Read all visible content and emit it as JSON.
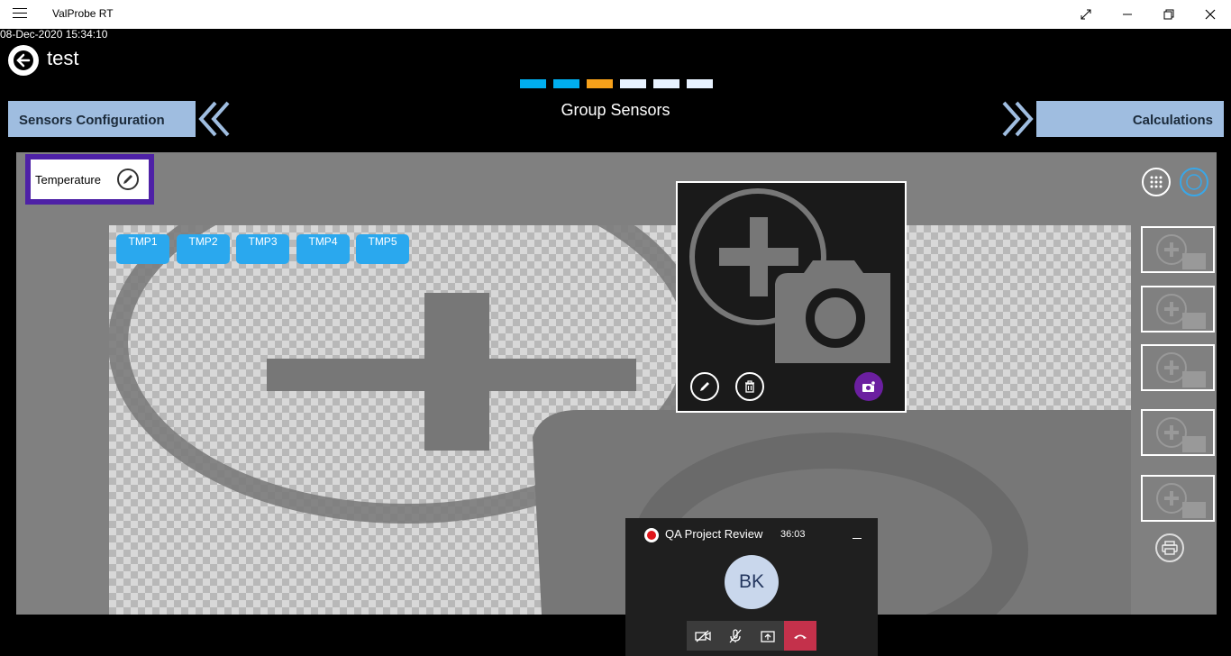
{
  "titlebar": {
    "app_title": "ValProbe RT",
    "menu_icon": "hamburger-icon",
    "buttons": [
      "fullscreen-icon",
      "minimize-icon",
      "restore-icon",
      "close-icon"
    ]
  },
  "timestamp": "08-Dec-2020 15:34:10",
  "header": {
    "title": "test",
    "back_icon": "back-arrow-icon"
  },
  "steps": [
    {
      "color": "#00aeef"
    },
    {
      "color": "#00aeef"
    },
    {
      "color": "#f7a11a"
    },
    {
      "color": "#e8f2ff"
    },
    {
      "color": "#e8f2ff"
    },
    {
      "color": "#e8f2ff"
    }
  ],
  "nav": {
    "prev_label": "Sensors Configuration",
    "center_label": "Group Sensors",
    "next_label": "Calculations"
  },
  "group": {
    "name": "Temperature",
    "edit_icon": "pencil-icon"
  },
  "sensors": [
    "TMP1",
    "TMP2",
    "TMP3",
    "TMP4",
    "TMP5"
  ],
  "image_popup": {
    "placeholder_icon": "add-photo-icon",
    "actions": [
      "pencil-icon",
      "trash-icon",
      "camera-settings-icon"
    ]
  },
  "side_tools": {
    "grid_icon": "grid-icon",
    "sync_icon": "sync-icon",
    "print_icon": "printer-icon"
  },
  "side_thumbnails": 5,
  "call": {
    "name": "QA Project Review",
    "time": "36:03",
    "initials": "BK",
    "controls": [
      "video-off-icon",
      "mic-off-icon",
      "share-screen-icon",
      "hang-up-icon"
    ]
  },
  "colors": {
    "accent": "#2aa8ee",
    "group_border": "#4e21a6",
    "tab_bg": "#9fbde0",
    "popup_accent": "#6b1fa0"
  }
}
